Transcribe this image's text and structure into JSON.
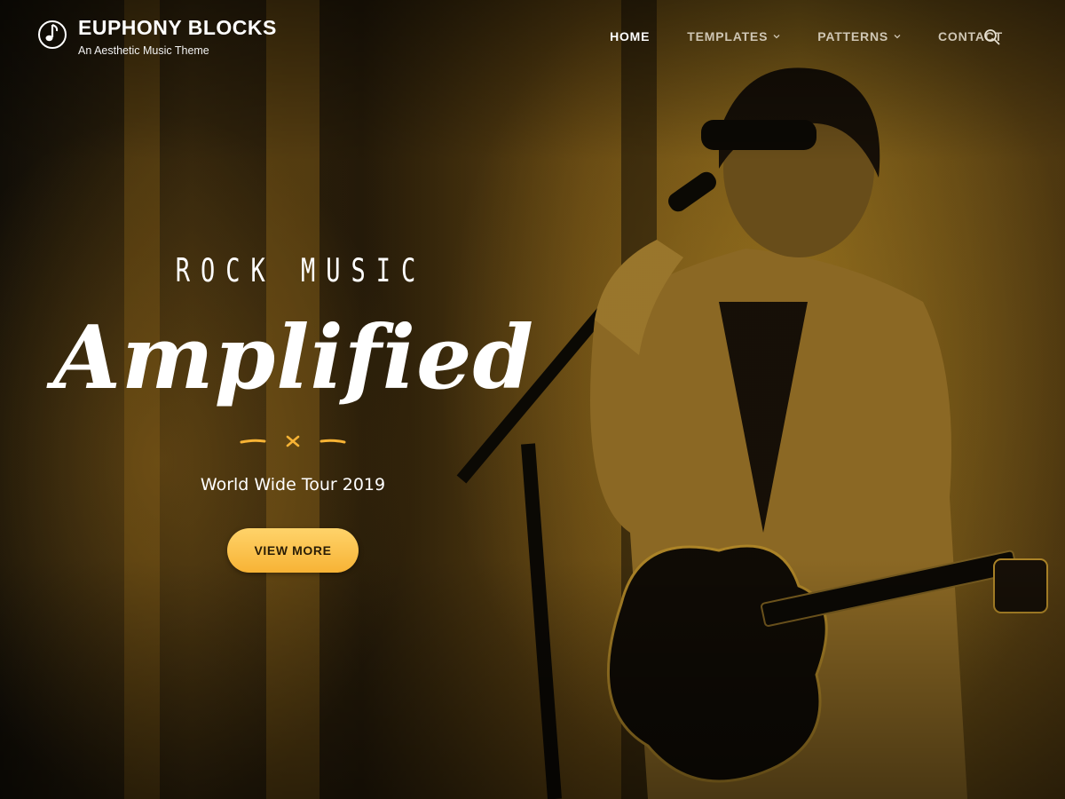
{
  "header": {
    "title": "EUPHONY BLOCKS",
    "tagline": "An Aesthetic Music Theme",
    "nav": [
      {
        "label": "HOME",
        "active": true
      },
      {
        "label": "TEMPLATES",
        "has_dropdown": true
      },
      {
        "label": "PATTERNS",
        "has_dropdown": true
      },
      {
        "label": "CONTACT"
      }
    ],
    "search_icon": "search-icon",
    "logo_icon": "music-note-icon"
  },
  "hero": {
    "eyebrow": "ROCK MUSIC",
    "headline": "Amplified",
    "subtitle": "World Wide Tour 2019",
    "cta_label": "VIEW MORE",
    "divider_icon": "x-divider-icon"
  },
  "colors": {
    "accent": "#f7b335",
    "accent_light": "#ffd36a",
    "photo_tint": "#c99a2e",
    "text": "#ffffff"
  }
}
